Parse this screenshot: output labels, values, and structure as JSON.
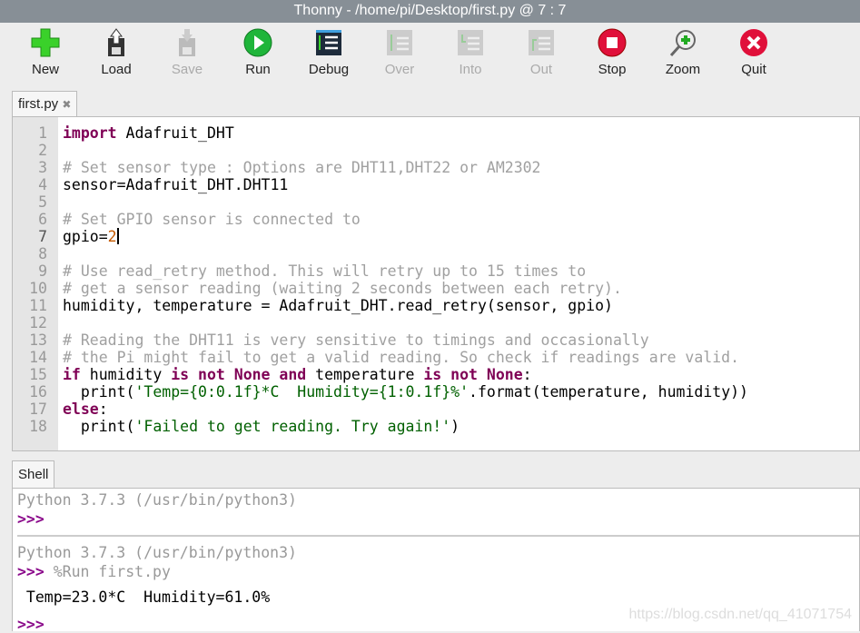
{
  "window": {
    "title": "Thonny  -  /home/pi/Desktop/first.py  @  7 : 7"
  },
  "toolbar": [
    {
      "label": "New",
      "icon": "new-file-icon",
      "enabled": true
    },
    {
      "label": "Load",
      "icon": "load-icon",
      "enabled": true
    },
    {
      "label": "Save",
      "icon": "save-icon",
      "enabled": false
    },
    {
      "label": "Run",
      "icon": "run-icon",
      "enabled": true
    },
    {
      "label": "Debug",
      "icon": "debug-icon",
      "enabled": true
    },
    {
      "label": "Over",
      "icon": "step-over-icon",
      "enabled": false
    },
    {
      "label": "Into",
      "icon": "step-into-icon",
      "enabled": false
    },
    {
      "label": "Out",
      "icon": "step-out-icon",
      "enabled": false
    },
    {
      "label": "Stop",
      "icon": "stop-icon",
      "enabled": true
    },
    {
      "label": "Zoom",
      "icon": "zoom-icon",
      "enabled": true
    },
    {
      "label": "Quit",
      "icon": "quit-icon",
      "enabled": true
    }
  ],
  "editor": {
    "tab": "first.py",
    "close": "✖",
    "current_line": 7,
    "lines": [
      [
        [
          "import",
          "k"
        ],
        [
          " Adafruit_DHT",
          ""
        ]
      ],
      [],
      [
        [
          "# Set sensor type : Options are DHT11,DHT22 or AM2302",
          "c"
        ]
      ],
      [
        [
          "sensor=Adafruit_DHT.DHT11",
          ""
        ]
      ],
      [],
      [
        [
          "# Set GPIO sensor is connected to",
          "c"
        ]
      ],
      [
        [
          "gpio=",
          ""
        ],
        [
          "2",
          "n"
        ]
      ],
      [],
      [
        [
          "# Use read_retry method. This will retry up to 15 times to",
          "c"
        ]
      ],
      [
        [
          "# get a sensor reading (waiting 2 seconds between each retry).",
          "c"
        ]
      ],
      [
        [
          "humidity, temperature = Adafruit_DHT.read_retry(sensor, gpio)",
          ""
        ]
      ],
      [],
      [
        [
          "# Reading the DHT11 is very sensitive to timings and occasionally",
          "c"
        ]
      ],
      [
        [
          "# the Pi might fail to get a valid reading. So check if readings are valid.",
          "c"
        ]
      ],
      [
        [
          "if",
          "k"
        ],
        [
          " humidity ",
          ""
        ],
        [
          "is not None and",
          "k"
        ],
        [
          " temperature ",
          ""
        ],
        [
          "is not None",
          "k"
        ],
        [
          ":",
          ""
        ]
      ],
      [
        [
          "  print(",
          ""
        ],
        [
          "'Temp={0:0.1f}*C  Humidity={1:0.1f}%'",
          "s"
        ],
        [
          ".format(temperature, humidity))",
          ""
        ]
      ],
      [
        [
          "else",
          "k"
        ],
        [
          ":",
          ""
        ]
      ],
      [
        [
          "  print(",
          ""
        ],
        [
          "'Failed to get reading. Try again!'",
          "s"
        ],
        [
          ")",
          ""
        ]
      ]
    ]
  },
  "shell": {
    "tab": "Shell",
    "banner1": "Python 3.7.3 (/usr/bin/python3)",
    "prompt": ">>>",
    "banner2": "Python 3.7.3 (/usr/bin/python3)",
    "command": " %Run first.py",
    "output": " Temp=23.0*C  Humidity=61.0%"
  },
  "watermark": "https://blog.csdn.net/qq_41071754"
}
